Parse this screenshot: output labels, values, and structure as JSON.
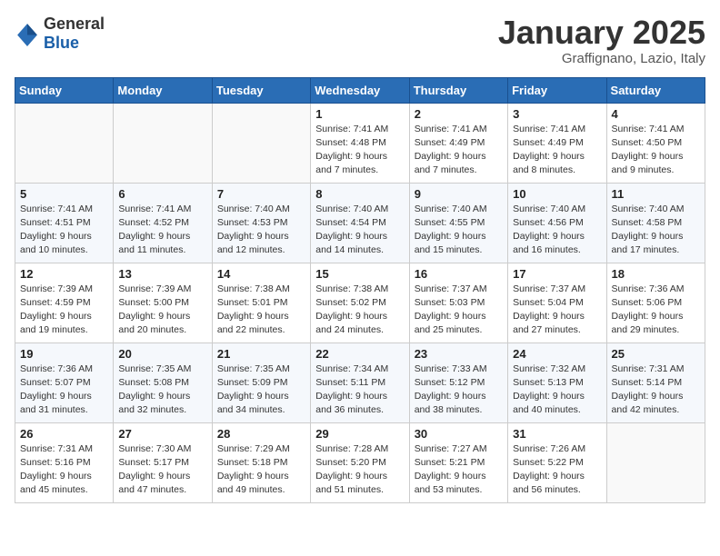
{
  "header": {
    "logo_general": "General",
    "logo_blue": "Blue",
    "title": "January 2025",
    "subtitle": "Graffignano, Lazio, Italy"
  },
  "days_of_week": [
    "Sunday",
    "Monday",
    "Tuesday",
    "Wednesday",
    "Thursday",
    "Friday",
    "Saturday"
  ],
  "weeks": [
    [
      {
        "day": "",
        "info": ""
      },
      {
        "day": "",
        "info": ""
      },
      {
        "day": "",
        "info": ""
      },
      {
        "day": "1",
        "info": "Sunrise: 7:41 AM\nSunset: 4:48 PM\nDaylight: 9 hours\nand 7 minutes."
      },
      {
        "day": "2",
        "info": "Sunrise: 7:41 AM\nSunset: 4:49 PM\nDaylight: 9 hours\nand 7 minutes."
      },
      {
        "day": "3",
        "info": "Sunrise: 7:41 AM\nSunset: 4:49 PM\nDaylight: 9 hours\nand 8 minutes."
      },
      {
        "day": "4",
        "info": "Sunrise: 7:41 AM\nSunset: 4:50 PM\nDaylight: 9 hours\nand 9 minutes."
      }
    ],
    [
      {
        "day": "5",
        "info": "Sunrise: 7:41 AM\nSunset: 4:51 PM\nDaylight: 9 hours\nand 10 minutes."
      },
      {
        "day": "6",
        "info": "Sunrise: 7:41 AM\nSunset: 4:52 PM\nDaylight: 9 hours\nand 11 minutes."
      },
      {
        "day": "7",
        "info": "Sunrise: 7:40 AM\nSunset: 4:53 PM\nDaylight: 9 hours\nand 12 minutes."
      },
      {
        "day": "8",
        "info": "Sunrise: 7:40 AM\nSunset: 4:54 PM\nDaylight: 9 hours\nand 14 minutes."
      },
      {
        "day": "9",
        "info": "Sunrise: 7:40 AM\nSunset: 4:55 PM\nDaylight: 9 hours\nand 15 minutes."
      },
      {
        "day": "10",
        "info": "Sunrise: 7:40 AM\nSunset: 4:56 PM\nDaylight: 9 hours\nand 16 minutes."
      },
      {
        "day": "11",
        "info": "Sunrise: 7:40 AM\nSunset: 4:58 PM\nDaylight: 9 hours\nand 17 minutes."
      }
    ],
    [
      {
        "day": "12",
        "info": "Sunrise: 7:39 AM\nSunset: 4:59 PM\nDaylight: 9 hours\nand 19 minutes."
      },
      {
        "day": "13",
        "info": "Sunrise: 7:39 AM\nSunset: 5:00 PM\nDaylight: 9 hours\nand 20 minutes."
      },
      {
        "day": "14",
        "info": "Sunrise: 7:38 AM\nSunset: 5:01 PM\nDaylight: 9 hours\nand 22 minutes."
      },
      {
        "day": "15",
        "info": "Sunrise: 7:38 AM\nSunset: 5:02 PM\nDaylight: 9 hours\nand 24 minutes."
      },
      {
        "day": "16",
        "info": "Sunrise: 7:37 AM\nSunset: 5:03 PM\nDaylight: 9 hours\nand 25 minutes."
      },
      {
        "day": "17",
        "info": "Sunrise: 7:37 AM\nSunset: 5:04 PM\nDaylight: 9 hours\nand 27 minutes."
      },
      {
        "day": "18",
        "info": "Sunrise: 7:36 AM\nSunset: 5:06 PM\nDaylight: 9 hours\nand 29 minutes."
      }
    ],
    [
      {
        "day": "19",
        "info": "Sunrise: 7:36 AM\nSunset: 5:07 PM\nDaylight: 9 hours\nand 31 minutes."
      },
      {
        "day": "20",
        "info": "Sunrise: 7:35 AM\nSunset: 5:08 PM\nDaylight: 9 hours\nand 32 minutes."
      },
      {
        "day": "21",
        "info": "Sunrise: 7:35 AM\nSunset: 5:09 PM\nDaylight: 9 hours\nand 34 minutes."
      },
      {
        "day": "22",
        "info": "Sunrise: 7:34 AM\nSunset: 5:11 PM\nDaylight: 9 hours\nand 36 minutes."
      },
      {
        "day": "23",
        "info": "Sunrise: 7:33 AM\nSunset: 5:12 PM\nDaylight: 9 hours\nand 38 minutes."
      },
      {
        "day": "24",
        "info": "Sunrise: 7:32 AM\nSunset: 5:13 PM\nDaylight: 9 hours\nand 40 minutes."
      },
      {
        "day": "25",
        "info": "Sunrise: 7:31 AM\nSunset: 5:14 PM\nDaylight: 9 hours\nand 42 minutes."
      }
    ],
    [
      {
        "day": "26",
        "info": "Sunrise: 7:31 AM\nSunset: 5:16 PM\nDaylight: 9 hours\nand 45 minutes."
      },
      {
        "day": "27",
        "info": "Sunrise: 7:30 AM\nSunset: 5:17 PM\nDaylight: 9 hours\nand 47 minutes."
      },
      {
        "day": "28",
        "info": "Sunrise: 7:29 AM\nSunset: 5:18 PM\nDaylight: 9 hours\nand 49 minutes."
      },
      {
        "day": "29",
        "info": "Sunrise: 7:28 AM\nSunset: 5:20 PM\nDaylight: 9 hours\nand 51 minutes."
      },
      {
        "day": "30",
        "info": "Sunrise: 7:27 AM\nSunset: 5:21 PM\nDaylight: 9 hours\nand 53 minutes."
      },
      {
        "day": "31",
        "info": "Sunrise: 7:26 AM\nSunset: 5:22 PM\nDaylight: 9 hours\nand 56 minutes."
      },
      {
        "day": "",
        "info": ""
      }
    ]
  ]
}
